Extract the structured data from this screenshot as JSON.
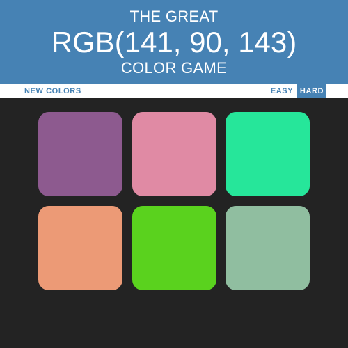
{
  "header": {
    "title_top": "THE GREAT",
    "rgb": "RGB(141, 90, 143)",
    "title_bottom": "COLOR GAME",
    "background": "#4682b4"
  },
  "stripe": {
    "new_colors_label": "NEW COLORS",
    "easy_label": "EASY",
    "hard_label": "HARD",
    "selected_mode": "HARD"
  },
  "squares": [
    {
      "color": "#8d5a8f"
    },
    {
      "color": "#e08aa4"
    },
    {
      "color": "#26e69a"
    },
    {
      "color": "#ec9a76"
    },
    {
      "color": "#5ad21e"
    },
    {
      "color": "#90bea0"
    }
  ],
  "page_background": "#232323"
}
